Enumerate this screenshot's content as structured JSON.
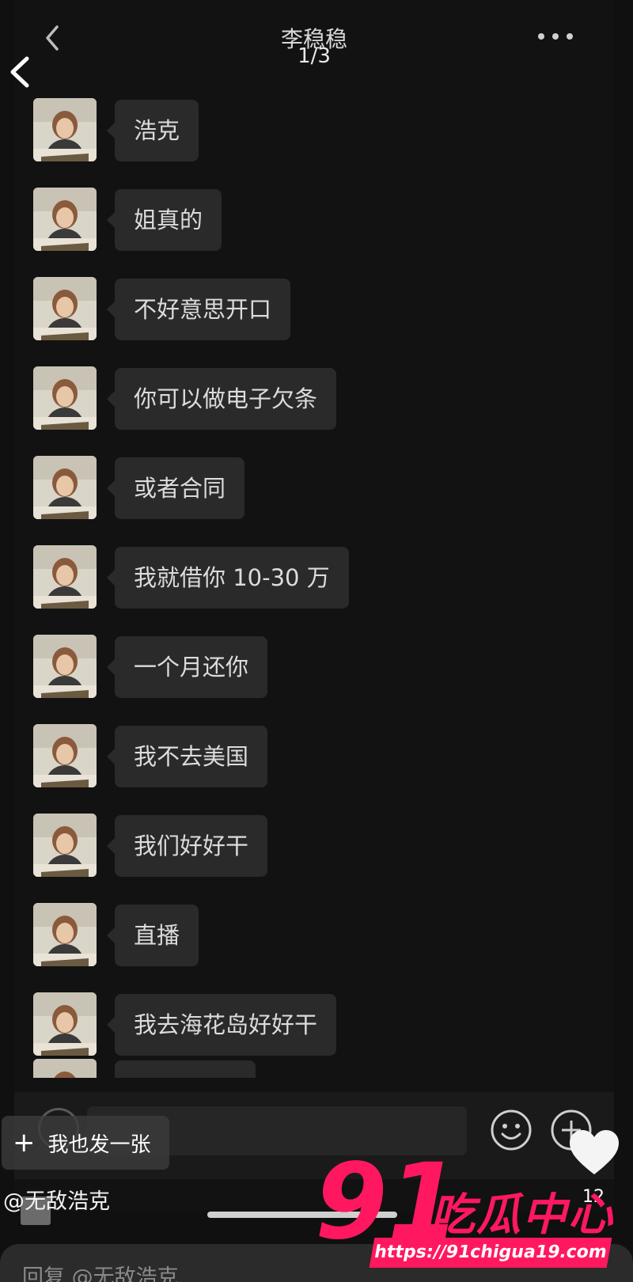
{
  "chat": {
    "title": "李稳稳",
    "page_counter": "1/3",
    "messages": [
      "浩克",
      "姐真的",
      "不好意思开口",
      "你可以做电子欠条",
      "或者合同",
      "我就借你 10-30 万",
      "一个月还你",
      "我不去美国",
      "我们好好干",
      "直播",
      "我去海花岛好好干"
    ]
  },
  "post": {
    "button_label": "我也发一张",
    "author": "@无敌浩克",
    "like_count": "12"
  },
  "reply": {
    "placeholder": "回复 @无敌浩克"
  },
  "watermark": {
    "brand_number": "91",
    "brand_text": "吃瓜中心",
    "url": "https://91chigua19.com"
  },
  "colors": {
    "background": "#101010",
    "bubble": "#2a2a2a",
    "watermark": "#ff1860"
  }
}
